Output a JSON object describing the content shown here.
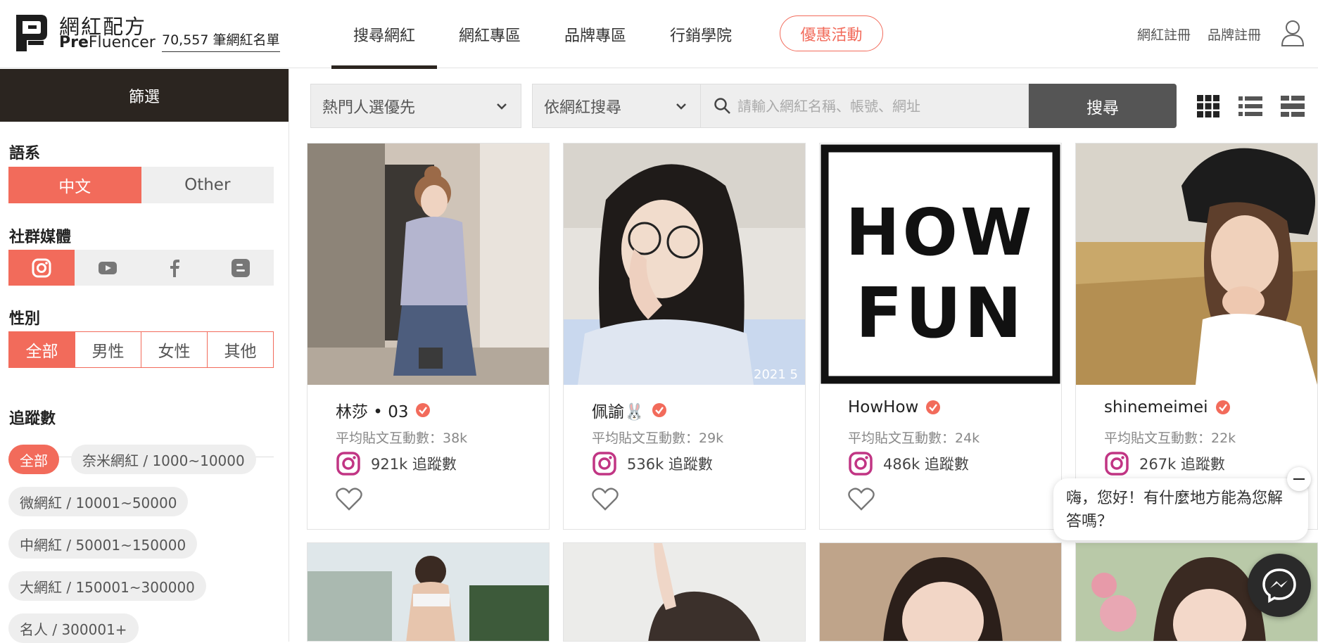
{
  "header": {
    "logo_zh": "網紅配方",
    "logo_en_bold": "Pre",
    "logo_en_rest": "Fluencer",
    "count_link": "70,557 筆網紅名單",
    "nav": [
      {
        "label": "搜尋網紅",
        "active": true
      },
      {
        "label": "網紅專區",
        "active": false
      },
      {
        "label": "品牌專區",
        "active": false
      },
      {
        "label": "行銷學院",
        "active": false
      }
    ],
    "promo": "優惠活動",
    "influencer_register": "網紅註冊",
    "brand_register": "品牌註冊"
  },
  "sidebar": {
    "title": "篩選",
    "language": {
      "label": "語系",
      "options": [
        "中文",
        "Other"
      ],
      "selected": "中文"
    },
    "social": {
      "label": "社群媒體",
      "options": [
        "instagram-icon",
        "youtube-icon",
        "facebook-icon",
        "blogger-icon"
      ],
      "selected": "instagram-icon"
    },
    "gender": {
      "label": "性別",
      "options": [
        "全部",
        "男性",
        "女性",
        "其他"
      ],
      "selected": "全部"
    },
    "followers": {
      "label": "追蹤數",
      "options": [
        "全部",
        "奈米網紅 / 1000~10000",
        "微網紅 / 10001~50000",
        "中網紅 / 50001~150000",
        "大網紅 / 150001~300000",
        "名人 / 300001+"
      ],
      "selected": "全部"
    }
  },
  "toolbar": {
    "sort": "熱門人選優先",
    "search_by": "依網紅搜尋",
    "search_placeholder": "請輸入網紅名稱、帳號、網址",
    "search_button": "搜尋"
  },
  "influencers": [
    {
      "name": "林莎 • 03",
      "engagement": "平均貼文互動數：38k",
      "followers": "921k 追蹤數"
    },
    {
      "name": "佩諭🐰",
      "engagement": "平均貼文互動數：29k",
      "followers": "536k 追蹤數"
    },
    {
      "name": "HowHow",
      "engagement": "平均貼文互動數：24k",
      "followers": "486k 追蹤數"
    },
    {
      "name": "shinemeimei",
      "engagement": "平均貼文互動數：22k",
      "followers": "267k 追蹤數"
    }
  ],
  "howhow_logo": [
    "HOW",
    "FUN"
  ],
  "photo_watermark": "2021 5",
  "chat": {
    "message": "嗨，您好！有什麼地方能為您解答嗎？"
  },
  "colors": {
    "accent": "#f26b5b",
    "dark": "#2b2520",
    "search_button": "#555555",
    "instagram": "#c13584"
  }
}
